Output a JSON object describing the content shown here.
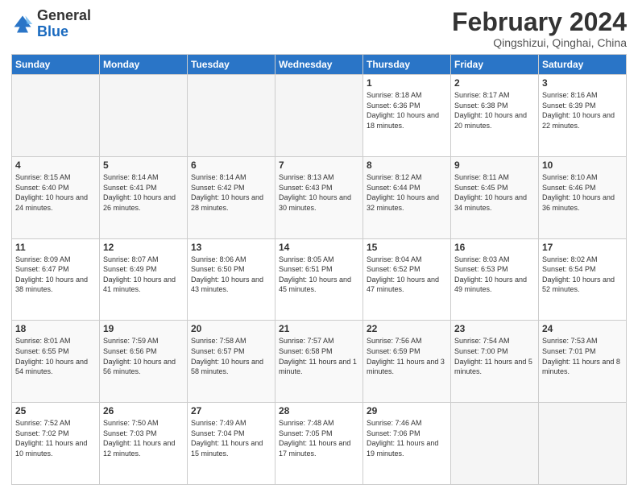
{
  "logo": {
    "general": "General",
    "blue": "Blue"
  },
  "header": {
    "title": "February 2024",
    "subtitle": "Qingshizui, Qinghai, China"
  },
  "weekdays": [
    "Sunday",
    "Monday",
    "Tuesday",
    "Wednesday",
    "Thursday",
    "Friday",
    "Saturday"
  ],
  "weeks": [
    [
      {
        "day": "",
        "empty": true
      },
      {
        "day": "",
        "empty": true
      },
      {
        "day": "",
        "empty": true
      },
      {
        "day": "",
        "empty": true
      },
      {
        "day": "1",
        "sunrise": "8:18 AM",
        "sunset": "6:36 PM",
        "daylight": "10 hours and 18 minutes."
      },
      {
        "day": "2",
        "sunrise": "8:17 AM",
        "sunset": "6:38 PM",
        "daylight": "10 hours and 20 minutes."
      },
      {
        "day": "3",
        "sunrise": "8:16 AM",
        "sunset": "6:39 PM",
        "daylight": "10 hours and 22 minutes."
      }
    ],
    [
      {
        "day": "4",
        "sunrise": "8:15 AM",
        "sunset": "6:40 PM",
        "daylight": "10 hours and 24 minutes."
      },
      {
        "day": "5",
        "sunrise": "8:14 AM",
        "sunset": "6:41 PM",
        "daylight": "10 hours and 26 minutes."
      },
      {
        "day": "6",
        "sunrise": "8:14 AM",
        "sunset": "6:42 PM",
        "daylight": "10 hours and 28 minutes."
      },
      {
        "day": "7",
        "sunrise": "8:13 AM",
        "sunset": "6:43 PM",
        "daylight": "10 hours and 30 minutes."
      },
      {
        "day": "8",
        "sunrise": "8:12 AM",
        "sunset": "6:44 PM",
        "daylight": "10 hours and 32 minutes."
      },
      {
        "day": "9",
        "sunrise": "8:11 AM",
        "sunset": "6:45 PM",
        "daylight": "10 hours and 34 minutes."
      },
      {
        "day": "10",
        "sunrise": "8:10 AM",
        "sunset": "6:46 PM",
        "daylight": "10 hours and 36 minutes."
      }
    ],
    [
      {
        "day": "11",
        "sunrise": "8:09 AM",
        "sunset": "6:47 PM",
        "daylight": "10 hours and 38 minutes."
      },
      {
        "day": "12",
        "sunrise": "8:07 AM",
        "sunset": "6:49 PM",
        "daylight": "10 hours and 41 minutes."
      },
      {
        "day": "13",
        "sunrise": "8:06 AM",
        "sunset": "6:50 PM",
        "daylight": "10 hours and 43 minutes."
      },
      {
        "day": "14",
        "sunrise": "8:05 AM",
        "sunset": "6:51 PM",
        "daylight": "10 hours and 45 minutes."
      },
      {
        "day": "15",
        "sunrise": "8:04 AM",
        "sunset": "6:52 PM",
        "daylight": "10 hours and 47 minutes."
      },
      {
        "day": "16",
        "sunrise": "8:03 AM",
        "sunset": "6:53 PM",
        "daylight": "10 hours and 49 minutes."
      },
      {
        "day": "17",
        "sunrise": "8:02 AM",
        "sunset": "6:54 PM",
        "daylight": "10 hours and 52 minutes."
      }
    ],
    [
      {
        "day": "18",
        "sunrise": "8:01 AM",
        "sunset": "6:55 PM",
        "daylight": "10 hours and 54 minutes."
      },
      {
        "day": "19",
        "sunrise": "7:59 AM",
        "sunset": "6:56 PM",
        "daylight": "10 hours and 56 minutes."
      },
      {
        "day": "20",
        "sunrise": "7:58 AM",
        "sunset": "6:57 PM",
        "daylight": "10 hours and 58 minutes."
      },
      {
        "day": "21",
        "sunrise": "7:57 AM",
        "sunset": "6:58 PM",
        "daylight": "11 hours and 1 minute."
      },
      {
        "day": "22",
        "sunrise": "7:56 AM",
        "sunset": "6:59 PM",
        "daylight": "11 hours and 3 minutes."
      },
      {
        "day": "23",
        "sunrise": "7:54 AM",
        "sunset": "7:00 PM",
        "daylight": "11 hours and 5 minutes."
      },
      {
        "day": "24",
        "sunrise": "7:53 AM",
        "sunset": "7:01 PM",
        "daylight": "11 hours and 8 minutes."
      }
    ],
    [
      {
        "day": "25",
        "sunrise": "7:52 AM",
        "sunset": "7:02 PM",
        "daylight": "11 hours and 10 minutes."
      },
      {
        "day": "26",
        "sunrise": "7:50 AM",
        "sunset": "7:03 PM",
        "daylight": "11 hours and 12 minutes."
      },
      {
        "day": "27",
        "sunrise": "7:49 AM",
        "sunset": "7:04 PM",
        "daylight": "11 hours and 15 minutes."
      },
      {
        "day": "28",
        "sunrise": "7:48 AM",
        "sunset": "7:05 PM",
        "daylight": "11 hours and 17 minutes."
      },
      {
        "day": "29",
        "sunrise": "7:46 AM",
        "sunset": "7:06 PM",
        "daylight": "11 hours and 19 minutes."
      },
      {
        "day": "",
        "empty": true
      },
      {
        "day": "",
        "empty": true
      }
    ]
  ]
}
